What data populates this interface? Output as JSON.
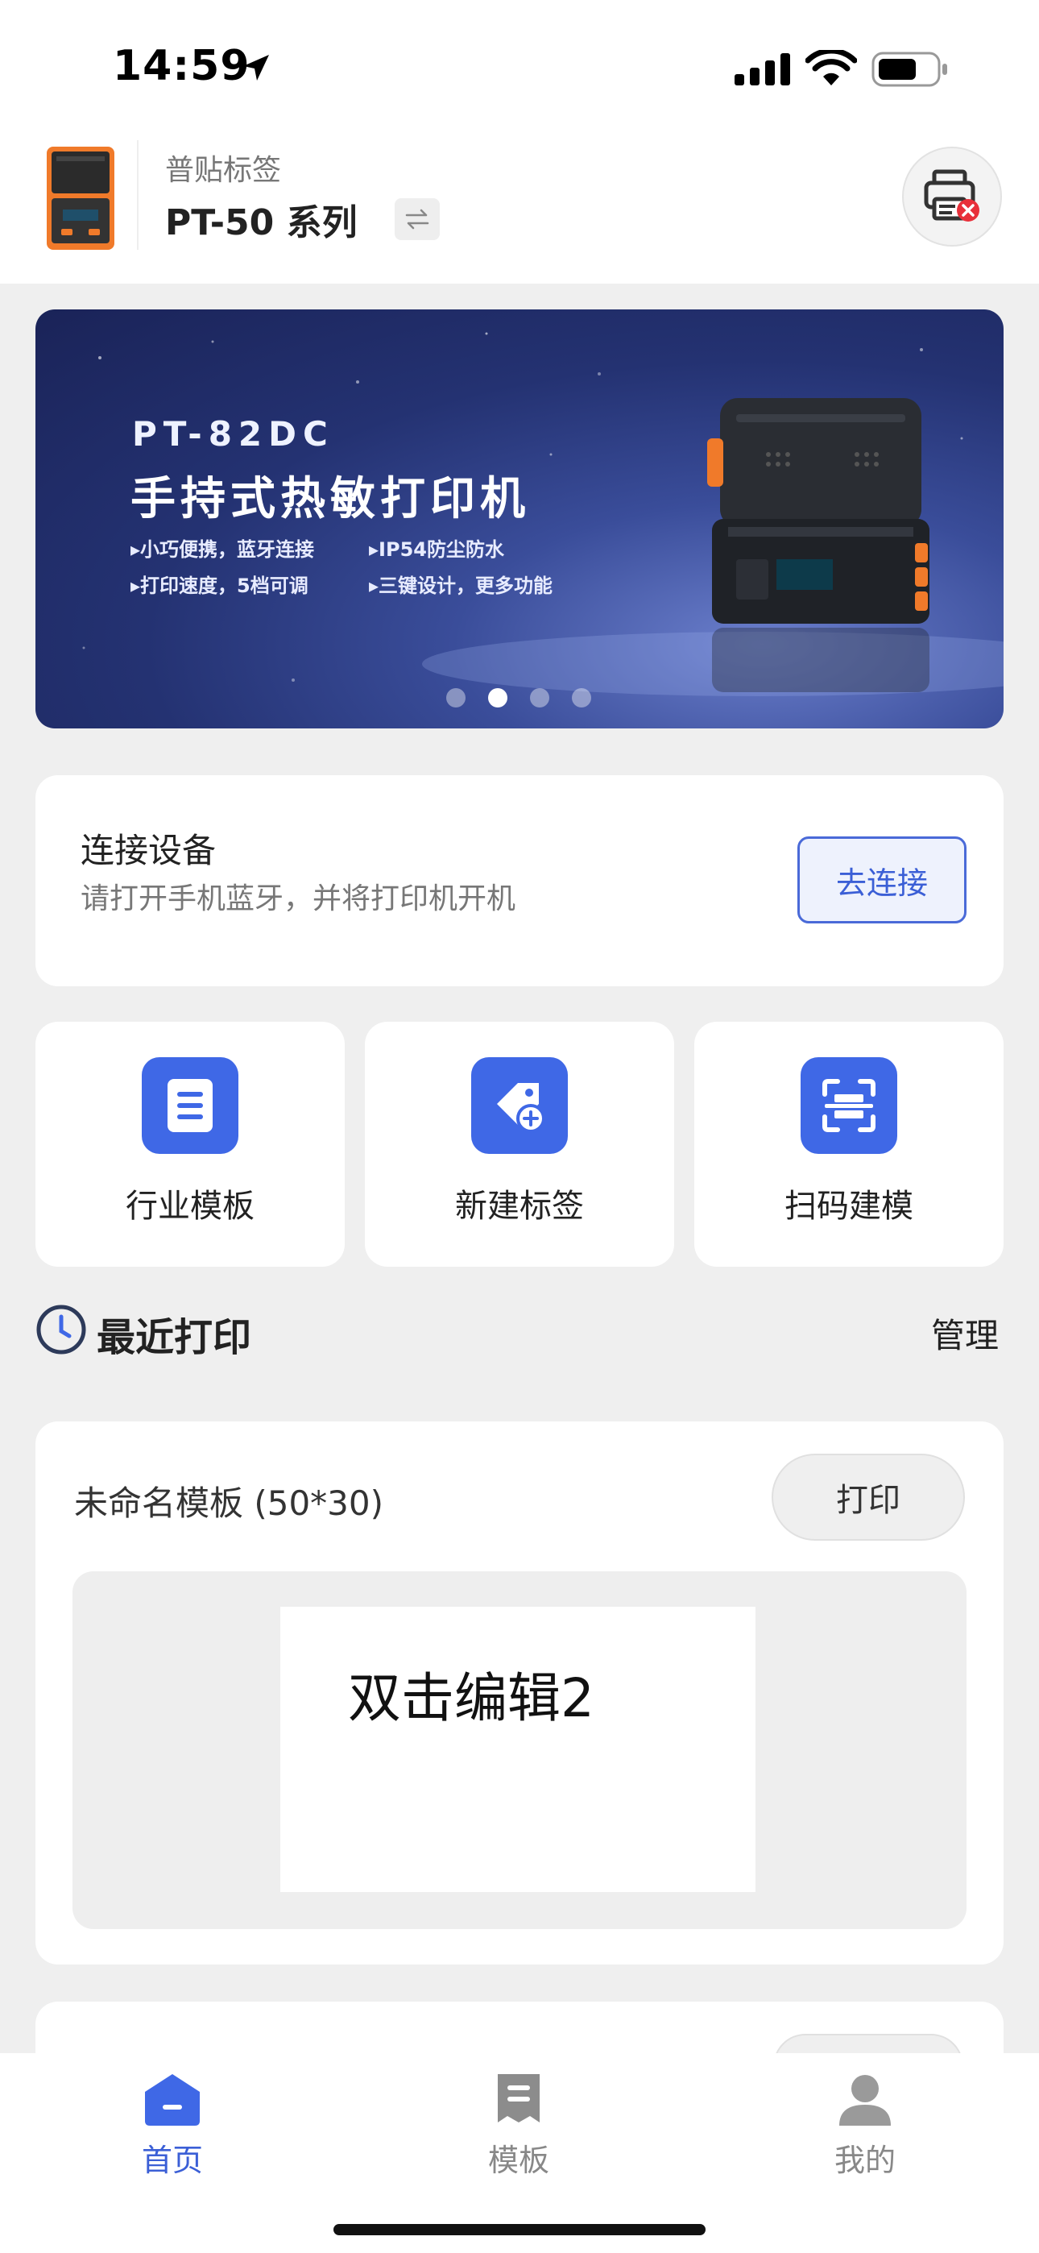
{
  "status_bar": {
    "time": "14:59"
  },
  "header": {
    "brand": "普贴标签",
    "model": "PT-50 系列"
  },
  "banner": {
    "title": "PT-82DC",
    "subtitle": "手持式热敏打印机",
    "features": [
      "▸小巧便携，蓝牙连接",
      "▸IP54防尘防水",
      "▸打印速度，5档可调",
      "▸三键设计，更多功能"
    ],
    "active_page": 2,
    "page_count": 4
  },
  "connect": {
    "title": "连接设备",
    "description": "请打开手机蓝牙，并将打印机开机",
    "button_label": "去连接"
  },
  "quick_actions": [
    {
      "label": "行业模板",
      "icon": "document-list-icon"
    },
    {
      "label": "新建标签",
      "icon": "tag-add-icon"
    },
    {
      "label": "扫码建模",
      "icon": "scan-icon"
    }
  ],
  "recent": {
    "title": "最近打印",
    "manage_label": "管理",
    "items": [
      {
        "name": "未命名模板 (50*30)",
        "print_label": "打印",
        "preview_text": "双击编辑2"
      }
    ]
  },
  "tabs": [
    {
      "label": "首页",
      "icon": "home-icon",
      "active": true
    },
    {
      "label": "模板",
      "icon": "template-icon",
      "active": false
    },
    {
      "label": "我的",
      "icon": "profile-icon",
      "active": false
    }
  ],
  "colors": {
    "accent": "#3f68e6",
    "tab_active": "#3b5fd6",
    "device_orange": "#f07a2a"
  }
}
